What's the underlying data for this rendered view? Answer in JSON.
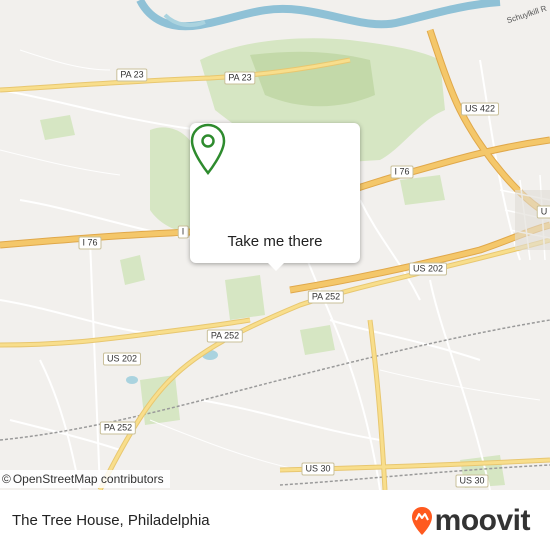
{
  "map": {
    "colors": {
      "background": "#f2f0ed",
      "park": "#d6e6c3",
      "park_dark": "#c3d9a9",
      "water": "#aad3df",
      "river": "#8fc1d6",
      "motorway": "#f4c76a",
      "primary": "#f8de8c",
      "minor": "#ffffff",
      "railway": "#9a9a9a",
      "accent": "#ff5a1f"
    },
    "road_labels": [
      {
        "id": "pa23-north",
        "text": "PA 23"
      },
      {
        "id": "pa23-west",
        "text": "PA 23"
      },
      {
        "id": "us422",
        "text": "US 422"
      },
      {
        "id": "i76-east",
        "text": "I 76"
      },
      {
        "id": "i76-west",
        "text": "I 76"
      },
      {
        "id": "i76-small",
        "text": "I"
      },
      {
        "id": "us202-east",
        "text": "US 202"
      },
      {
        "id": "pa252-center",
        "text": "PA 252"
      },
      {
        "id": "pa252-west",
        "text": "PA 252"
      },
      {
        "id": "us202-west",
        "text": "US 202"
      },
      {
        "id": "pa252-south",
        "text": "PA 252"
      },
      {
        "id": "us30-center",
        "text": "US 30"
      },
      {
        "id": "us30-east",
        "text": "US 30"
      },
      {
        "id": "edge-right",
        "text": "U"
      }
    ],
    "water_labels": [
      {
        "id": "schuylkill",
        "text": "Schuylkill R"
      }
    ]
  },
  "popup": {
    "icon": "location-pin-icon",
    "cta_label": "Take me there"
  },
  "attribution": {
    "copyright_symbol": "©",
    "text": "OpenStreetMap contributors"
  },
  "footer": {
    "place_name": "The Tree House, Philadelphia",
    "brand": "moovit",
    "brand_icon": "moovit-pin-icon"
  }
}
